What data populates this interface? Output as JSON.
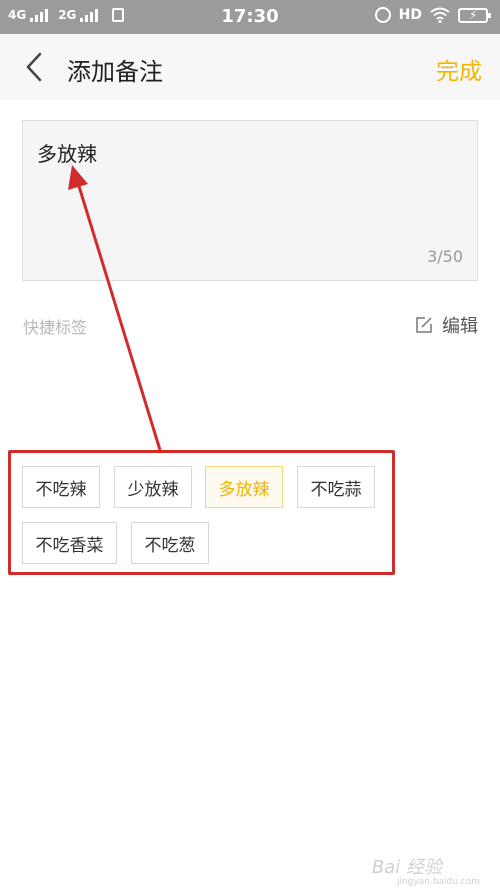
{
  "status_bar": {
    "network1": "4G",
    "network2": "2G",
    "time": "17:30",
    "hd": "HD",
    "icons": [
      "signal-icon",
      "sim-icon",
      "alarm-icon",
      "wifi-icon",
      "battery-charging-icon"
    ]
  },
  "nav": {
    "title": "添加备注",
    "done_label": "完成",
    "back_icon": "chevron-left-icon",
    "accent_color": "#f2b600"
  },
  "note": {
    "value": "多放辣",
    "counter": "3/50"
  },
  "quick_tags": {
    "label": "快捷标签",
    "edit_label": "编辑",
    "items": [
      "不吃辣",
      "少放辣",
      "多放辣",
      "不吃蒜",
      "不吃香菜",
      "不吃葱"
    ],
    "selected": "多放辣"
  },
  "annotation": {
    "color": "#d22b2b"
  },
  "watermark": {
    "text": "Bai 经验",
    "sub": "jingyan.baidu.com"
  }
}
